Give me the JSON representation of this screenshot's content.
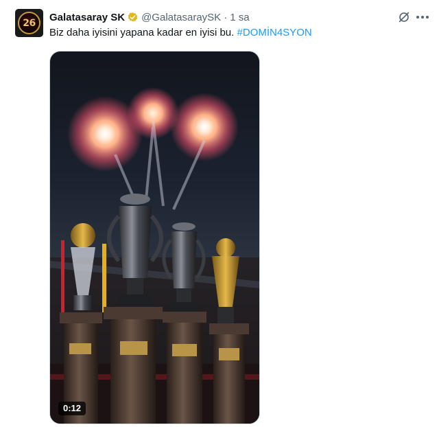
{
  "tweet": {
    "display_name": "Galatasaray SK",
    "handle": "@GalatasaraySK",
    "separator": "·",
    "time": "1 sa",
    "text": "Biz daha iyisini yapana kadar en iyisi bu.",
    "hashtag": "#DOMİN4SYON",
    "avatar_text": "26",
    "verified_badge": "gold-verified-icon",
    "media": {
      "kind": "video",
      "duration": "0:12"
    }
  },
  "colors": {
    "hashtag": "#1d9bf0",
    "secondary_text": "#536471",
    "verified_gold": "#e2b719",
    "border": "#cfd9de"
  }
}
